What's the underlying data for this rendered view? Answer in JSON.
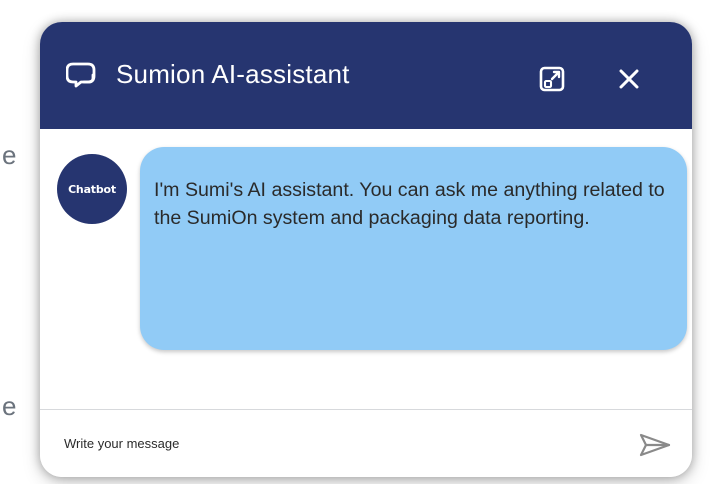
{
  "background": {
    "edge_glyph_top": "e",
    "edge_glyph_bottom": "e"
  },
  "header": {
    "title": "Sumion AI-assistant",
    "icon": "chat-bubbles-icon",
    "expand_icon": "expand-icon",
    "close_icon": "close-icon"
  },
  "message": {
    "avatar_label": "Chatbot",
    "text": "I'm Sumi's AI assistant. You can ask me anything related to the SumiOn system and packaging data reporting."
  },
  "composer": {
    "placeholder": "Write your message",
    "value": "",
    "send_icon": "send-icon"
  },
  "colors": {
    "header": "#263570",
    "bubble": "#91cbf6",
    "text": "#2a2a2a"
  }
}
